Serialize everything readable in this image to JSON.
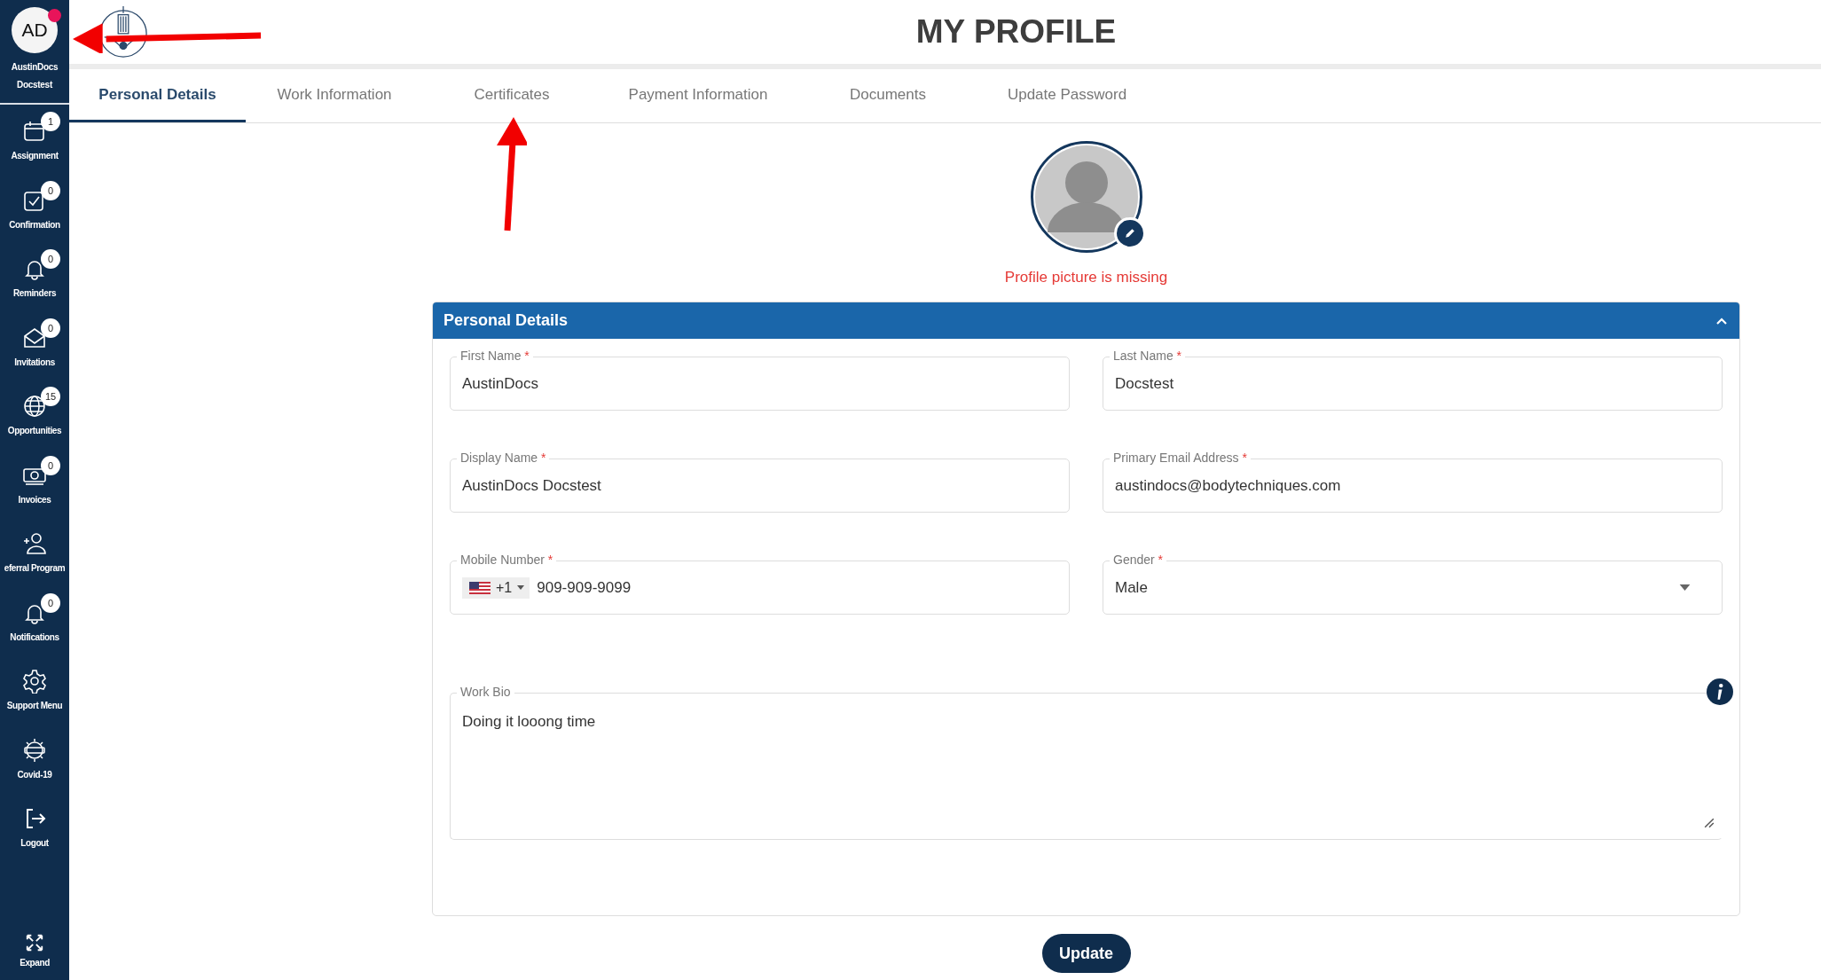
{
  "sidebar": {
    "user": {
      "initials": "AD",
      "online": true,
      "name_lines": [
        "AustinDocs",
        "Docstest"
      ]
    },
    "items": [
      {
        "label": "Assignment",
        "badge": "1"
      },
      {
        "label": "Confirmation",
        "badge": "0"
      },
      {
        "label": "Reminders",
        "badge": "0"
      },
      {
        "label": "Invitations",
        "badge": "0"
      },
      {
        "label": "Opportunities",
        "badge": "15"
      },
      {
        "label": "Invoices",
        "badge": "0"
      },
      {
        "label": "eferral Program"
      },
      {
        "label": "Notifications",
        "badge": "0"
      },
      {
        "label": "Support Menu"
      },
      {
        "label": "Covid-19"
      },
      {
        "label": "Logout"
      }
    ],
    "expand": {
      "label": "Expand"
    }
  },
  "header": {
    "title": "MY PROFILE"
  },
  "tabs": [
    {
      "label": "Personal Details",
      "selected": true
    },
    {
      "label": "Work Information",
      "selected": false
    },
    {
      "label": "Certificates",
      "selected": false
    },
    {
      "label": "Payment Information",
      "selected": false
    },
    {
      "label": "Documents",
      "selected": false
    },
    {
      "label": "Update Password",
      "selected": false
    }
  ],
  "profile_picture": {
    "warning": "Profile picture is missing"
  },
  "panel": {
    "title": "Personal Details",
    "expanded": true,
    "fields": [
      {
        "kind": "text",
        "label": "First Name",
        "required_mark": "*",
        "value": "AustinDocs"
      },
      {
        "kind": "text",
        "label": "Last Name",
        "required_mark": "*",
        "value": "Docstest"
      },
      {
        "kind": "text",
        "label": "Display Name",
        "required_mark": "*",
        "value": "AustinDocs Docstest"
      },
      {
        "kind": "text",
        "label": "Primary Email Address",
        "required_mark": "*",
        "value": "austindocs@bodytechniques.com"
      },
      {
        "kind": "phone",
        "label": "Mobile Number",
        "required_mark": "*",
        "country_code": "+1",
        "value": "909-909-9099"
      },
      {
        "kind": "select",
        "label": "Gender",
        "required_mark": "*",
        "value": "Male"
      }
    ],
    "work_bio": {
      "label": "Work Bio",
      "value": "Doing it looong time"
    }
  },
  "update_button": {
    "label": "Update"
  }
}
